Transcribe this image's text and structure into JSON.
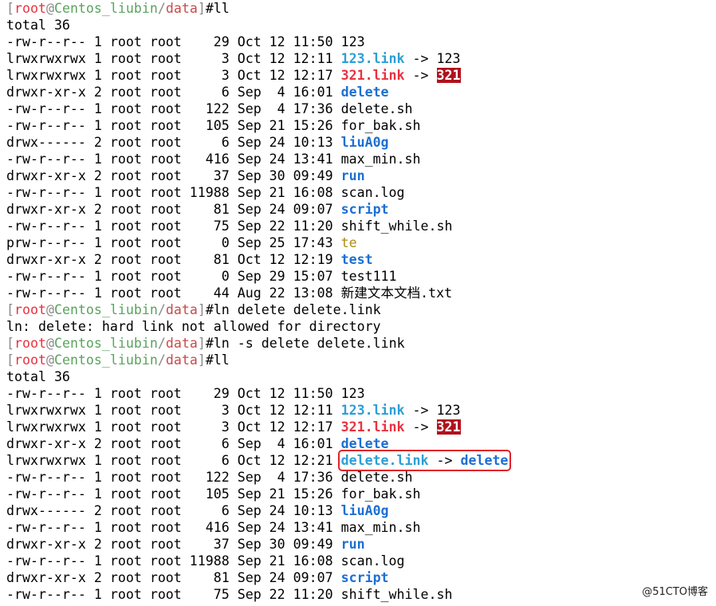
{
  "prompt": {
    "user": "root",
    "at": "@",
    "host": "Centos_liubin",
    "dir": "data",
    "hash": "#",
    "open": "[",
    "close": "]"
  },
  "block1": [
    {
      "text": "ll",
      "kind": "prompt"
    },
    {
      "text": "total 36",
      "kind": "text"
    },
    {
      "perm": "-rw-r--r--",
      "rest": " 1 root root    29 Oct 12 11:50 ",
      "name": "123"
    },
    {
      "perm": "lrwxrwxrwx",
      "rest": " 1 root root     3 Oct 12 12:11 ",
      "name": "123.link",
      "arrow": " -> ",
      "target": "123"
    },
    {
      "perm": "lrwxrwxrwx",
      "rest": " 1 root root     3 Oct 12 12:17 ",
      "name": "321.link",
      "arrow": " -> ",
      "target": "321"
    },
    {
      "perm": "drwxr-xr-x",
      "rest": " 2 root root     6 Sep  4 16:01 ",
      "name": "delete"
    },
    {
      "perm": "-rw-r--r--",
      "rest": " 1 root root   122 Sep  4 17:36 ",
      "name": "delete.sh"
    },
    {
      "perm": "-rw-r--r--",
      "rest": " 1 root root   105 Sep 21 15:26 ",
      "name": "for_bak.sh"
    },
    {
      "perm": "drwx------",
      "rest": " 2 root root     6 Sep 24 10:13 ",
      "name": "liuA0g"
    },
    {
      "perm": "-rw-r--r--",
      "rest": " 1 root root   416 Sep 24 13:41 ",
      "name": "max_min.sh"
    },
    {
      "perm": "drwxr-xr-x",
      "rest": " 2 root root    37 Sep 30 09:49 ",
      "name": "run"
    },
    {
      "perm": "-rw-r--r--",
      "rest": " 1 root root 11988 Sep 21 16:08 ",
      "name": "scan.log"
    },
    {
      "perm": "drwxr-xr-x",
      "rest": " 2 root root    81 Sep 24 09:07 ",
      "name": "script"
    },
    {
      "perm": "-rw-r--r--",
      "rest": " 1 root root    75 Sep 22 11:20 ",
      "name": "shift_while.sh"
    },
    {
      "perm": "prw-r--r--",
      "rest": " 1 root root     0 Sep 25 17:43 ",
      "name": "te"
    },
    {
      "perm": "drwxr-xr-x",
      "rest": " 2 root root    81 Oct 12 12:19 ",
      "name": "test"
    },
    {
      "perm": "-rw-r--r--",
      "rest": " 1 root root     0 Sep 29 15:07 ",
      "name": "test111"
    },
    {
      "perm": "-rw-r--r--",
      "rest": " 1 root root    44 Aug 22 13:08 ",
      "name": "新建文本文档.txt"
    }
  ],
  "cmd_hardlink": "ln delete delete.link",
  "error_line": "ln: delete: hard link not allowed for directory",
  "cmd_symlink": "ln -s delete delete.link",
  "cmd_ll2": "ll",
  "block2": [
    {
      "text": "total 36"
    },
    {
      "perm": "-rw-r--r--",
      "rest": " 1 root root    29 Oct 12 11:50 ",
      "name": "123"
    },
    {
      "perm": "lrwxrwxrwx",
      "rest": " 1 root root     3 Oct 12 12:11 ",
      "name": "123.link",
      "arrow": " -> ",
      "target": "123"
    },
    {
      "perm": "lrwxrwxrwx",
      "rest": " 1 root root     3 Oct 12 12:17 ",
      "name": "321.link",
      "arrow": " -> ",
      "target": "321"
    },
    {
      "perm": "drwxr-xr-x",
      "rest": " 2 root root     6 Sep  4 16:01 ",
      "name": "delete"
    },
    {
      "perm": "lrwxrwxrwx",
      "rest": " 1 root root     6 Oct 12 12:21 ",
      "name": "delete.link",
      "arrow": " -> ",
      "target": "delete"
    },
    {
      "perm": "-rw-r--r--",
      "rest": " 1 root root   122 Sep  4 17:36 ",
      "name": "delete.sh"
    },
    {
      "perm": "-rw-r--r--",
      "rest": " 1 root root   105 Sep 21 15:26 ",
      "name": "for_bak.sh"
    },
    {
      "perm": "drwx------",
      "rest": " 2 root root     6 Sep 24 10:13 ",
      "name": "liuA0g"
    },
    {
      "perm": "-rw-r--r--",
      "rest": " 1 root root   416 Sep 24 13:41 ",
      "name": "max_min.sh"
    },
    {
      "perm": "drwxr-xr-x",
      "rest": " 2 root root    37 Sep 30 09:49 ",
      "name": "run"
    },
    {
      "perm": "-rw-r--r--",
      "rest": " 1 root root 11988 Sep 21 16:08 ",
      "name": "scan.log"
    },
    {
      "perm": "drwxr-xr-x",
      "rest": " 2 root root    81 Sep 24 09:07 ",
      "name": "script"
    },
    {
      "perm": "-rw-r--r--",
      "rest": " 1 root root    75 Sep 22 11:20 ",
      "name": "shift_while.sh"
    }
  ],
  "watermark": "@51CTO博客",
  "colors": {
    "cyan_link": "#2b9fd6",
    "dir_blue": "#1c6fd3",
    "broken_red": "#e8323f",
    "highlight_box": "#e0222a",
    "pipe_yellow": "#b08a14"
  }
}
